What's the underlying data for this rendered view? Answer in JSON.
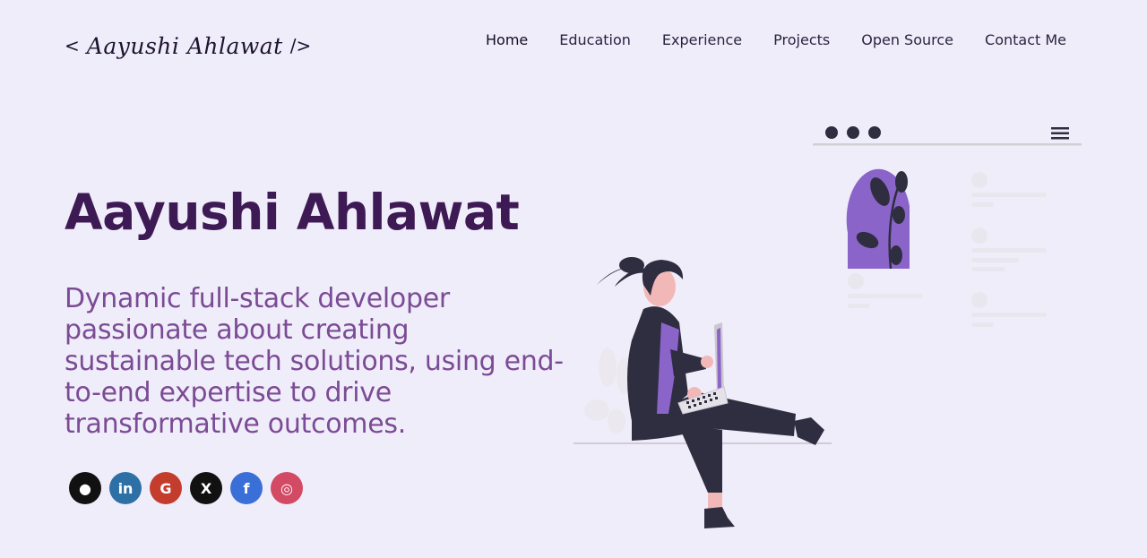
{
  "header": {
    "logo": {
      "open": "<",
      "name": "Aayushi Ahlawat",
      "close": "/>"
    },
    "nav": [
      {
        "label": "Home"
      },
      {
        "label": "Education"
      },
      {
        "label": "Experience"
      },
      {
        "label": "Projects"
      },
      {
        "label": "Open Source"
      },
      {
        "label": "Contact Me"
      }
    ]
  },
  "hero": {
    "name": "Aayushi Ahlawat",
    "description": "Dynamic full-stack developer passionate about creating sustainable tech solutions, using end-to-end expertise to drive transformative outcomes."
  },
  "socials": [
    {
      "icon": "github-icon",
      "glyph": "●",
      "color": "#111111"
    },
    {
      "icon": "linkedin-icon",
      "glyph": "in",
      "color": "#2d70a6"
    },
    {
      "icon": "google-icon",
      "glyph": "G",
      "color": "#c43c2c"
    },
    {
      "icon": "x-icon",
      "glyph": "X",
      "color": "#111111"
    },
    {
      "icon": "facebook-icon",
      "glyph": "f",
      "color": "#3b6fd8"
    },
    {
      "icon": "instagram-icon",
      "glyph": "◎",
      "color": "#d24a63"
    }
  ],
  "colors": {
    "background": "#f0edfa",
    "heading": "#3e1a55",
    "subtitle": "#7b4b95",
    "accent": "#8a64c9"
  }
}
